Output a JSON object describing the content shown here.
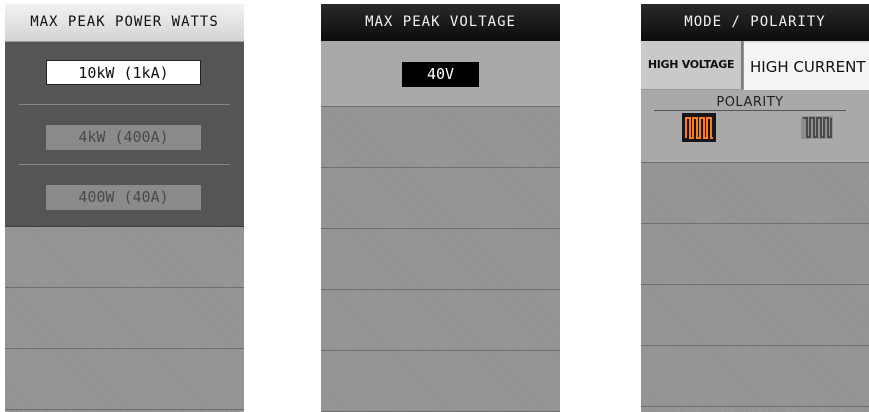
{
  "watts_panel": {
    "title": "MAX PEAK POWER WATTS",
    "options": [
      {
        "label": "10kW (1kA)",
        "state": "selected"
      },
      {
        "label": "4kW (400A)",
        "state": "disabled"
      },
      {
        "label": "400W (40A)",
        "state": "disabled"
      }
    ]
  },
  "voltage_panel": {
    "title": "MAX PEAK VOLTAGE",
    "value": "40V"
  },
  "mode_panel": {
    "title": "MODE / POLARITY",
    "tabs": [
      {
        "label": "HIGH VOLTAGE",
        "active": false
      },
      {
        "label": "HIGH CURRENT",
        "active": true
      }
    ],
    "polarity_label": "POLARITY",
    "polarity_options": [
      {
        "icon": "positive-pulse-icon",
        "active": true,
        "color": "#ff7a1a"
      },
      {
        "icon": "negative-pulse-icon",
        "active": false,
        "color": "#555555"
      }
    ]
  },
  "colors": {
    "header_dark": "#111111",
    "selected_bg": "#ffffff",
    "accent_orange": "#ff7a1a"
  }
}
